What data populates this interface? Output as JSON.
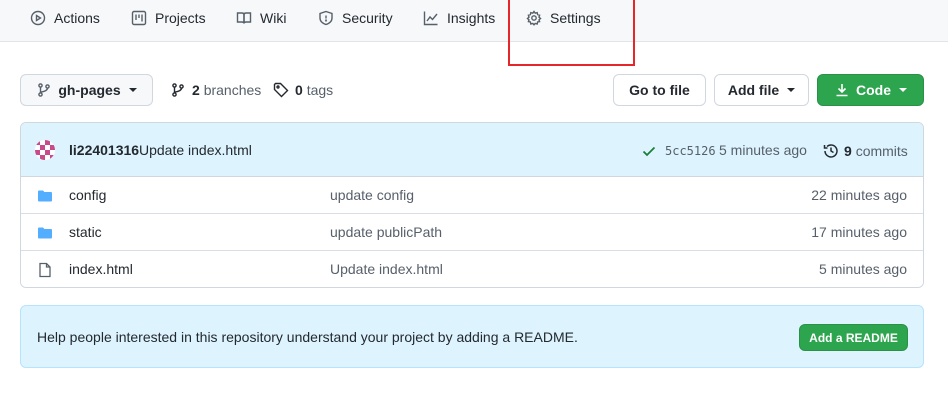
{
  "nav": {
    "items": [
      {
        "label": "Actions",
        "icon": "play-icon"
      },
      {
        "label": "Projects",
        "icon": "project-icon"
      },
      {
        "label": "Wiki",
        "icon": "book-icon"
      },
      {
        "label": "Security",
        "icon": "shield-icon"
      },
      {
        "label": "Insights",
        "icon": "graph-icon"
      },
      {
        "label": "Settings",
        "icon": "gear-icon"
      }
    ],
    "highlight_color": "#e5262b"
  },
  "toolbar": {
    "branch": "gh-pages",
    "branches_count": "2",
    "branches_label": "branches",
    "tags_count": "0",
    "tags_label": "tags",
    "go_to_file": "Go to file",
    "add_file": "Add file",
    "code": "Code"
  },
  "commit": {
    "author": "li22401316",
    "message": "Update index.html",
    "sha": "5cc5126",
    "time": "5 minutes ago",
    "commits_count": "9",
    "commits_label": "commits"
  },
  "files": [
    {
      "name": "config",
      "type": "folder",
      "message": "update config",
      "time": "22 minutes ago"
    },
    {
      "name": "static",
      "type": "folder",
      "message": "update publicPath",
      "time": "17 minutes ago"
    },
    {
      "name": "index.html",
      "type": "file",
      "message": "Update index.html",
      "time": "5 minutes ago"
    }
  ],
  "readme": {
    "text": "Help people interested in this repository understand your project by adding a README.",
    "button": "Add a README"
  },
  "colors": {
    "accent_green": "#2da44e",
    "folder_blue": "#54aeff",
    "banner_blue": "#ddf4ff"
  }
}
